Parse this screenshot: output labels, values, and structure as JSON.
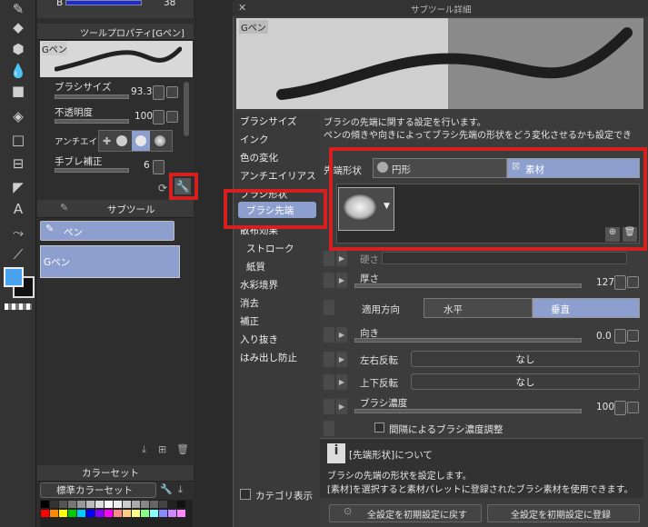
{
  "left_toolbar": {
    "tools": [
      "pen-icon",
      "eraser-icon",
      "fill-icon",
      "blend-icon",
      "gradient-icon",
      "fill-bucket-icon",
      "rect-select-icon",
      "frame-icon",
      "ruler-icon",
      "text-icon",
      "lasso-icon",
      "operation-icon"
    ]
  },
  "top_strip": {
    "label_b": "B",
    "value": "38"
  },
  "tool_property": {
    "title": "ツールプロパティ[Gペン]",
    "preset_name": "Gペン",
    "brush_size_label": "ブラシサイズ",
    "brush_size_value": "93.3",
    "opacity_label": "不透明度",
    "opacity_value": "100",
    "antialias_label": "アンチエイ",
    "stabilization_label": "手ブレ補正",
    "stabilization_value": "6"
  },
  "subtool": {
    "title": "サブツール",
    "group": "ペン",
    "item": "Gペン"
  },
  "colorset": {
    "title": "カラーセット",
    "set_name": "標準カラーセット"
  },
  "dialog": {
    "title": "サブツール詳細",
    "preview_label": "Gペン",
    "categories": [
      "ブラシサイズ",
      "インク",
      "色の変化",
      "アンチエイリアス",
      "ブラシ形状",
      "ブラシ先端",
      "散布効果",
      "ストローク",
      "紙質",
      "水彩境界",
      "消去",
      "補正",
      "入り抜き",
      "はみ出し防止"
    ],
    "selected_category": "ブラシ先端",
    "description_line1": "ブラシの先端に関する設定を行います。",
    "description_line2": "ペンの傾きや向きによってブラシ先端の形状をどう変化させるかも設定でき",
    "tip_shape_label": "先端形状",
    "tip_shape_circle": "円形",
    "tip_shape_material": "素材",
    "hardness_label": "硬さ",
    "thickness_label": "厚さ",
    "thickness_value": "127",
    "apply_dir_label": "適用方向",
    "apply_dir_horizontal": "水平",
    "apply_dir_vertical": "垂直",
    "direction_label": "向き",
    "direction_value": "0.0",
    "flip_h_label": "左右反転",
    "flip_h_value": "なし",
    "flip_v_label": "上下反転",
    "flip_v_value": "なし",
    "density_label": "ブラシ濃度",
    "density_value": "100",
    "interval_density_label": "間隔によるブラシ濃度調整",
    "info_title": "[先端形状]について",
    "info_line1": "ブラシの先端の形状を設定します。",
    "info_line2": "[素材]を選択すると素材パレットに登録されたブラシ素材を使用できます。",
    "category_display": "カテゴリ表示",
    "reset_button": "全設定を初期設定に戻す",
    "register_button": "全設定を初期設定に登録"
  },
  "colors": {
    "accent_red": "#d61f1f",
    "selected_blue": "#8c9fce",
    "fg_color": "#4aa3f0"
  }
}
